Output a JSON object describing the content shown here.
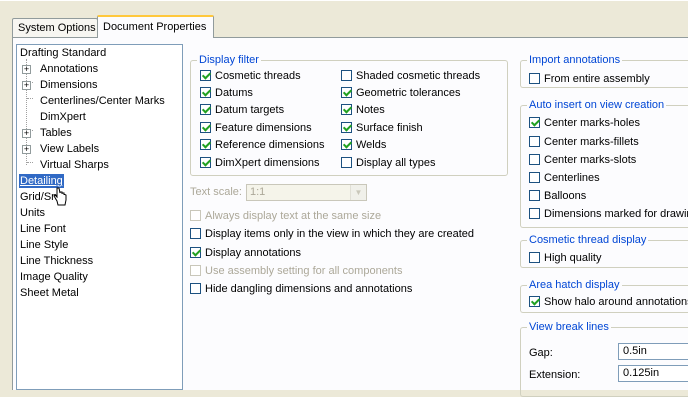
{
  "tabs": [
    {
      "label": "System Options"
    },
    {
      "label": "Document Properties"
    }
  ],
  "tree": {
    "items": [
      {
        "label": "Drafting Standard"
      },
      {
        "label": "Annotations"
      },
      {
        "label": "Dimensions"
      },
      {
        "label": "Centerlines/Center Marks"
      },
      {
        "label": "DimXpert"
      },
      {
        "label": "Tables"
      },
      {
        "label": "View Labels"
      },
      {
        "label": "Virtual Sharps"
      },
      {
        "label": "Detailing"
      },
      {
        "label": "Grid/Sn"
      },
      {
        "label": "Units"
      },
      {
        "label": "Line Font"
      },
      {
        "label": "Line Style"
      },
      {
        "label": "Line Thickness"
      },
      {
        "label": "Image Quality"
      },
      {
        "label": "Sheet Metal"
      }
    ],
    "expander": "+"
  },
  "display_filter": {
    "title": "Display filter",
    "options": [
      {
        "label": "Cosmetic threads",
        "checked": true
      },
      {
        "label": "Shaded cosmetic threads",
        "checked": false
      },
      {
        "label": "Datums",
        "checked": true
      },
      {
        "label": "Geometric tolerances",
        "checked": true
      },
      {
        "label": "Datum targets",
        "checked": true
      },
      {
        "label": "Notes",
        "checked": true
      },
      {
        "label": "Feature dimensions",
        "checked": true
      },
      {
        "label": "Surface finish",
        "checked": true
      },
      {
        "label": "Reference dimensions",
        "checked": true
      },
      {
        "label": "Welds",
        "checked": true
      },
      {
        "label": "DimXpert dimensions",
        "checked": true
      },
      {
        "label": "Display all types",
        "checked": false
      }
    ]
  },
  "text_scale": {
    "label": "Text scale:",
    "value": "1:1",
    "arrow": "▼"
  },
  "options": [
    {
      "label": "Always display text at the same size",
      "checked": false,
      "disabled": true
    },
    {
      "label": "Display items only in the view in which they are created",
      "checked": false,
      "disabled": false
    },
    {
      "label": "Display annotations",
      "checked": true,
      "disabled": false
    },
    {
      "label": "Use assembly setting for all components",
      "checked": false,
      "disabled": true
    },
    {
      "label": "Hide dangling dimensions and annotations",
      "checked": false,
      "disabled": false
    }
  ],
  "import_annotations": {
    "title": "Import annotations",
    "options": [
      {
        "label": "From entire assembly",
        "checked": false
      }
    ]
  },
  "auto_insert": {
    "title": "Auto insert on view creation",
    "options": [
      {
        "label": "Center marks-holes",
        "checked": true
      },
      {
        "label": "Center marks-fillets",
        "checked": false
      },
      {
        "label": "Center marks-slots",
        "checked": false
      },
      {
        "label": "Centerlines",
        "checked": false
      },
      {
        "label": "Balloons",
        "checked": false
      },
      {
        "label": "Dimensions marked for drawin",
        "checked": false
      }
    ]
  },
  "cosmetic_thread": {
    "title": "Cosmetic thread display",
    "options": [
      {
        "label": "High quality",
        "checked": false
      }
    ]
  },
  "area_hatch": {
    "title": "Area hatch display",
    "options": [
      {
        "label": "Show halo around annotations",
        "checked": true
      }
    ]
  },
  "view_break": {
    "title": "View break lines",
    "gap_label": "Gap:",
    "gap_value": "0.5in",
    "extension_label": "Extension:",
    "extension_value": "0.125in"
  }
}
